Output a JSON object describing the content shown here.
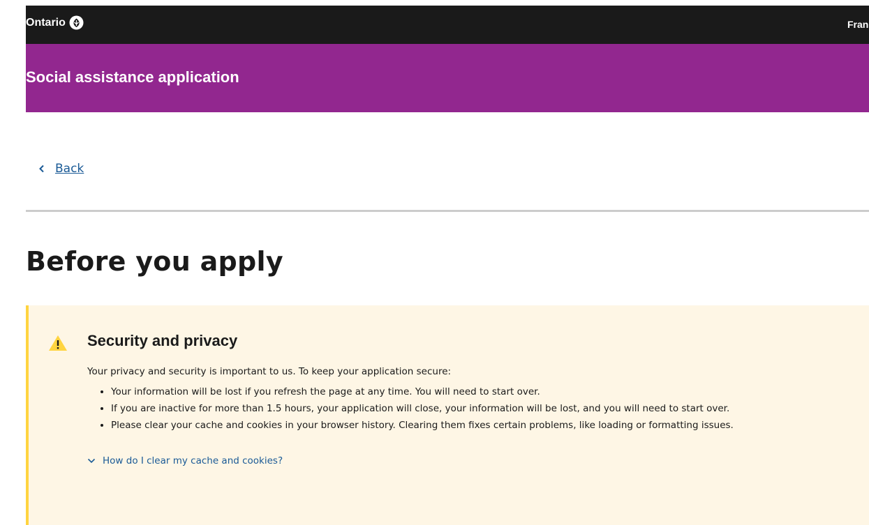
{
  "header": {
    "brand": "Ontario",
    "brand_icon": "ontario-trillium-logo",
    "language_link": "Français"
  },
  "app_bar": {
    "title": "Social assistance application",
    "color": "#92278f"
  },
  "nav": {
    "back_label": "Back",
    "back_icon": "chevron-left-icon"
  },
  "main": {
    "title": "Before you apply"
  },
  "callout": {
    "icon": "warning-icon",
    "heading": "Security and privacy",
    "intro": "Your privacy and security is important to us. To keep your application secure:",
    "items": [
      "Your information will be lost if you refresh the page at any time. You will need to start over.",
      "If you are inactive for more than 1.5 hours, your application will close, your information will be lost, and you will need to start over.",
      "Please clear your cache and cookies in your browser history. Clearing them fixes certain problems, like loading or formatting issues."
    ],
    "details_label": "How do I clear my cache and cookies?",
    "background": "#fef6e5",
    "accent": "#ffd440"
  },
  "colors": {
    "topbar": "#1a1a1a",
    "link": "#1a5a96"
  }
}
